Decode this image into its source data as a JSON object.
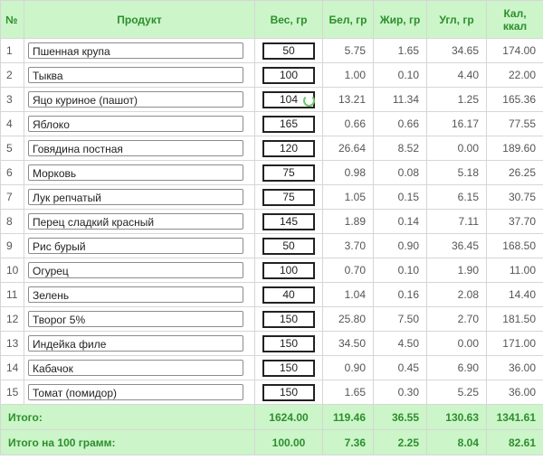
{
  "headers": {
    "num": "№",
    "product": "Продукт",
    "weight": "Вес, гр",
    "protein": "Бел, гр",
    "fat": "Жир, гр",
    "carbs": "Угл, гр",
    "cal_line1": "Кал,",
    "cal_line2": "ккал"
  },
  "rows": [
    {
      "n": "1",
      "product": "Пшенная крупа",
      "weight": "50",
      "protein": "5.75",
      "fat": "1.65",
      "carbs": "34.65",
      "cal": "174.00"
    },
    {
      "n": "2",
      "product": "Тыква",
      "weight": "100",
      "protein": "1.00",
      "fat": "0.10",
      "carbs": "4.40",
      "cal": "22.00"
    },
    {
      "n": "3",
      "product": "Яцо куриное (пашот)",
      "weight": "104",
      "protein": "13.21",
      "fat": "11.34",
      "carbs": "1.25",
      "cal": "165.36"
    },
    {
      "n": "4",
      "product": "Яблоко",
      "weight": "165",
      "protein": "0.66",
      "fat": "0.66",
      "carbs": "16.17",
      "cal": "77.55"
    },
    {
      "n": "5",
      "product": "Говядина постная",
      "weight": "120",
      "protein": "26.64",
      "fat": "8.52",
      "carbs": "0.00",
      "cal": "189.60"
    },
    {
      "n": "6",
      "product": "Морковь",
      "weight": "75",
      "protein": "0.98",
      "fat": "0.08",
      "carbs": "5.18",
      "cal": "26.25"
    },
    {
      "n": "7",
      "product": "Лук репчатый",
      "weight": "75",
      "protein": "1.05",
      "fat": "0.15",
      "carbs": "6.15",
      "cal": "30.75"
    },
    {
      "n": "8",
      "product": "Перец сладкий красный",
      "weight": "145",
      "protein": "1.89",
      "fat": "0.14",
      "carbs": "7.11",
      "cal": "37.70"
    },
    {
      "n": "9",
      "product": "Рис бурый",
      "weight": "50",
      "protein": "3.70",
      "fat": "0.90",
      "carbs": "36.45",
      "cal": "168.50"
    },
    {
      "n": "10",
      "product": "Огурец",
      "weight": "100",
      "protein": "0.70",
      "fat": "0.10",
      "carbs": "1.90",
      "cal": "11.00"
    },
    {
      "n": "11",
      "product": "Зелень",
      "weight": "40",
      "protein": "1.04",
      "fat": "0.16",
      "carbs": "2.08",
      "cal": "14.40"
    },
    {
      "n": "12",
      "product": "Творог 5%",
      "weight": "150",
      "protein": "25.80",
      "fat": "7.50",
      "carbs": "2.70",
      "cal": "181.50"
    },
    {
      "n": "13",
      "product": "Индейка филе",
      "weight": "150",
      "protein": "34.50",
      "fat": "4.50",
      "carbs": "0.00",
      "cal": "171.00"
    },
    {
      "n": "14",
      "product": "Кабачок",
      "weight": "150",
      "protein": "0.90",
      "fat": "0.45",
      "carbs": "6.90",
      "cal": "36.00"
    },
    {
      "n": "15",
      "product": "Томат (помидор)",
      "weight": "150",
      "protein": "1.65",
      "fat": "0.30",
      "carbs": "5.25",
      "cal": "36.00"
    }
  ],
  "totals": {
    "label": "Итого:",
    "weight": "1624.00",
    "protein": "119.46",
    "fat": "36.55",
    "carbs": "130.63",
    "cal": "1341.61"
  },
  "per100": {
    "label": "Итого на 100 грамм:",
    "weight": "100.00",
    "protein": "7.36",
    "fat": "2.25",
    "carbs": "8.04",
    "cal": "82.61"
  },
  "loading_row": "3"
}
